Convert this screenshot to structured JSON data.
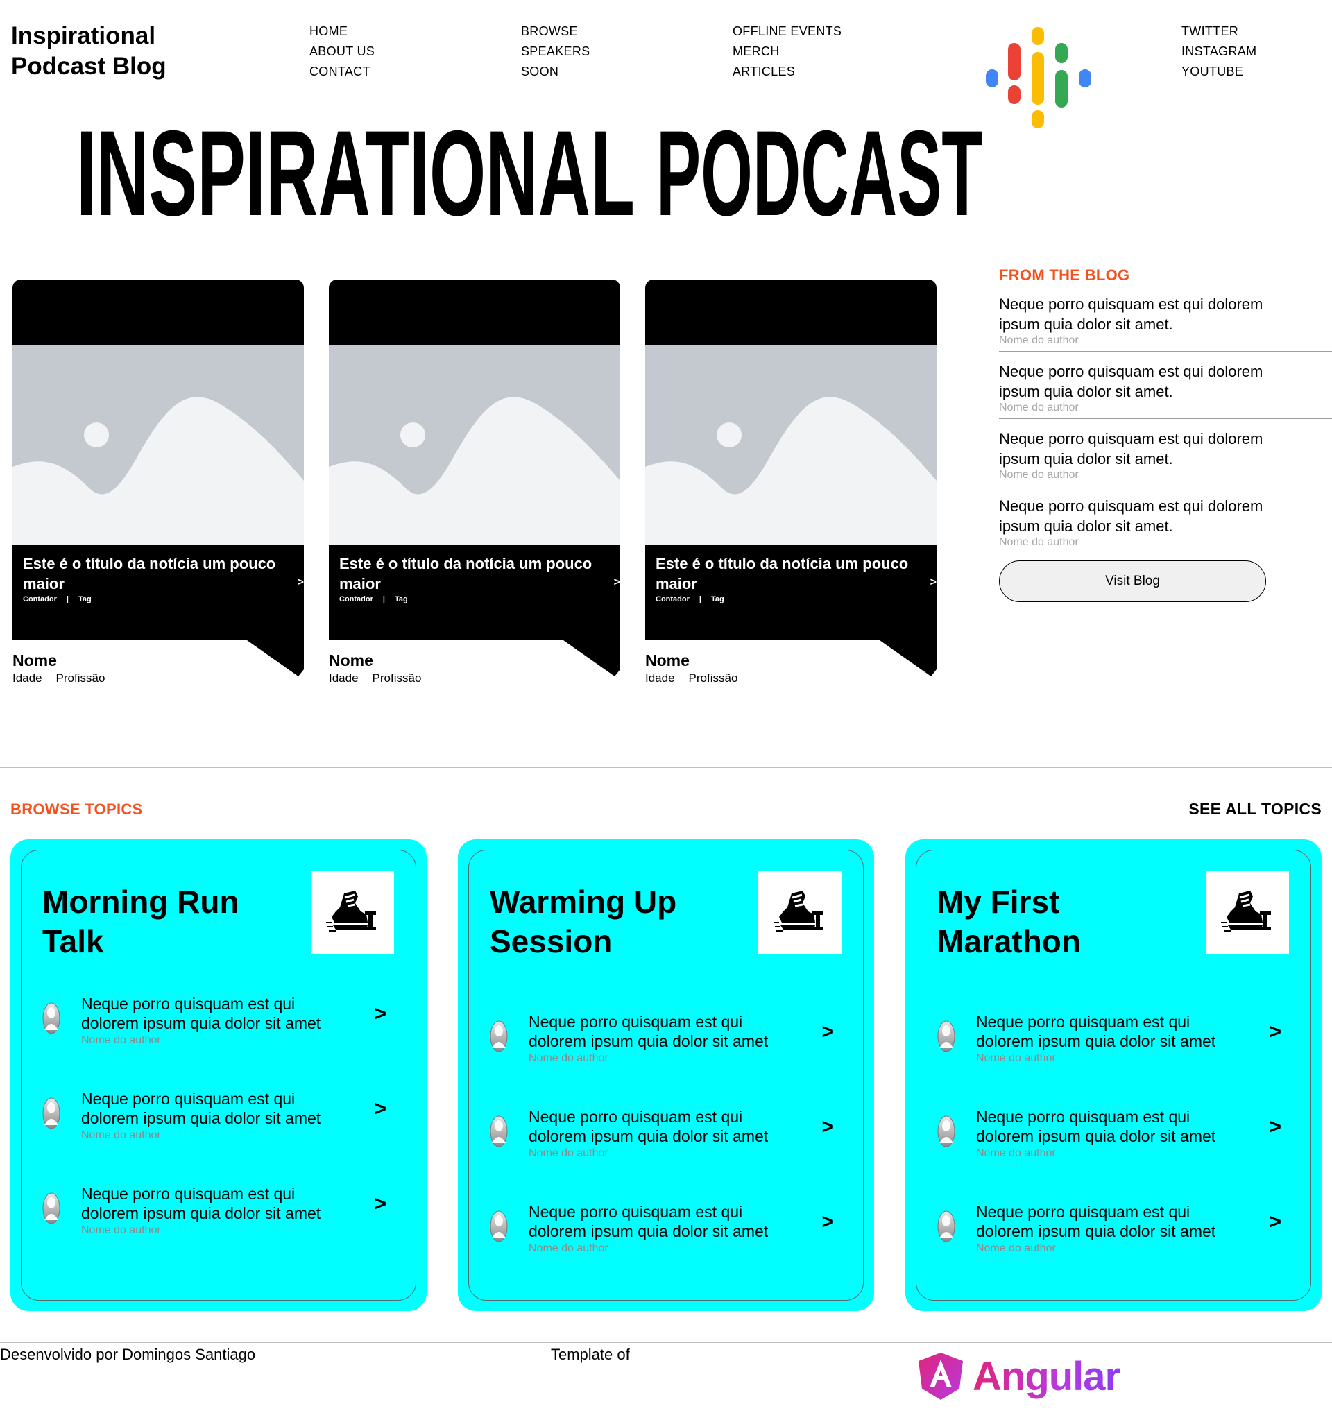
{
  "header": {
    "brand_line1": "Inspirational",
    "brand_line2": "Podcast Blog",
    "nav_columns": [
      [
        "HOME",
        "ABOUT US",
        "CONTACT"
      ],
      [
        "BROWSE",
        "SPEAKERS",
        "SOON"
      ],
      [
        "OFFLINE EVENTS",
        "MERCH",
        "ARTICLES"
      ],
      [
        "TWITTER",
        "INSTAGRAM",
        "YOUTUBE"
      ]
    ],
    "logo_icon": "podcast-bars-icon",
    "logo_colors": [
      "#4285f4",
      "#ea4335",
      "#fbbc04",
      "#34a853"
    ]
  },
  "hero": {
    "word1": "INSPIRATIONAL",
    "word2": "PODCAST"
  },
  "feature_cards": [
    {
      "title": "Este é o título da notícia um pouco maior",
      "category": "Contador",
      "tag": "Tag",
      "arrow": ">",
      "name": "Nome",
      "age": "Idade",
      "profession": "Profissão"
    },
    {
      "title": "Este é o título da notícia um pouco maior",
      "category": "Contador",
      "tag": "Tag",
      "arrow": ">",
      "name": "Nome",
      "age": "Idade",
      "profession": "Profissão"
    },
    {
      "title": "Este é o título da notícia um pouco maior",
      "category": "Contador",
      "tag": "Tag",
      "arrow": ">",
      "name": "Nome",
      "age": "Idade",
      "profession": "Profissão"
    }
  ],
  "blog": {
    "heading": "FROM THE BLOG",
    "items": [
      {
        "text": "Neque porro quisquam est qui dolorem ipsum quia dolor sit amet.",
        "author": "Nome do author"
      },
      {
        "text": "Neque porro quisquam est qui dolorem ipsum quia dolor sit amet.",
        "author": "Nome do author"
      },
      {
        "text": "Neque porro quisquam est qui dolorem ipsum quia dolor sit amet.",
        "author": "Nome do author"
      },
      {
        "text": "Neque porro quisquam est qui dolorem ipsum quia dolor sit amet.",
        "author": "Nome do author"
      }
    ],
    "button_label": "Visit Blog"
  },
  "topics": {
    "heading": "BROWSE TOPICS",
    "see_all": "SEE ALL TOPICS",
    "cards": [
      {
        "title": "Morning Run Talk",
        "icon": "running-shoe-icon",
        "items": [
          {
            "text": "Neque porro quisquam est qui dolorem ipsum quia dolor sit amet",
            "author": "Nome do author",
            "arrow": ">"
          },
          {
            "text": "Neque porro quisquam est qui dolorem ipsum quia dolor sit amet",
            "author": "Nome do author",
            "arrow": ">"
          },
          {
            "text": "Neque porro quisquam est qui dolorem ipsum quia dolor sit amet",
            "author": "Nome do author",
            "arrow": ">"
          }
        ]
      },
      {
        "title": "Warming Up Session",
        "icon": "running-shoe-icon",
        "items": [
          {
            "text": "Neque porro quisquam est qui dolorem ipsum quia dolor sit amet",
            "author": "Nome do author",
            "arrow": ">"
          },
          {
            "text": "Neque porro quisquam est qui dolorem ipsum quia dolor sit amet",
            "author": "Nome do author",
            "arrow": ">"
          },
          {
            "text": "Neque porro quisquam est qui dolorem ipsum quia dolor sit amet",
            "author": "Nome do author",
            "arrow": ">"
          }
        ]
      },
      {
        "title": "My First Marathon",
        "icon": "running-shoe-icon",
        "items": [
          {
            "text": "Neque porro quisquam est qui dolorem ipsum quia dolor sit amet",
            "author": "Nome do author",
            "arrow": ">"
          },
          {
            "text": "Neque porro quisquam est qui dolorem ipsum quia dolor sit amet",
            "author": "Nome do author",
            "arrow": ">"
          },
          {
            "text": "Neque porro quisquam est qui dolorem ipsum quia dolor sit amet",
            "author": "Nome do author",
            "arrow": ">"
          }
        ]
      }
    ]
  },
  "footer": {
    "developed_by": "Desenvolvido por Domingos Santiago",
    "template_of": "Template of",
    "angular_word": "Angular",
    "angular_icon": "angular-logo-icon"
  },
  "colors": {
    "accent_orange": "#f4511e",
    "topic_cyan": "#00ffff",
    "placeholder_gray": "#c4c9d0"
  }
}
